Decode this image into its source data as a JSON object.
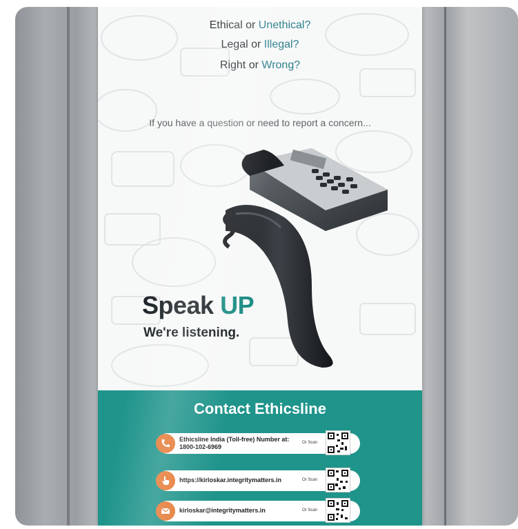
{
  "poster": {
    "questions": [
      {
        "a": "Ethical",
        "or": " or ",
        "b": "Unethical?"
      },
      {
        "a": "Legal",
        "or": " or ",
        "b": "Illegal?"
      },
      {
        "a": "Right",
        "or": " or ",
        "b": "Wrong?"
      }
    ],
    "prompt": "If you have a question or need to report a concern...",
    "headline_a": "Speak ",
    "headline_b": "UP",
    "tagline": "We're listening.",
    "contact_title": "Contact Ethicsline",
    "contacts": [
      {
        "icon": "phone-icon",
        "line1": "Ethicsline India (Toll-free) Number at:",
        "line2": "1800-102-6969",
        "or_scan": "Or Scan"
      },
      {
        "icon": "hand-pointer-icon",
        "line1": "https://kirloskar.integritymatters.in",
        "line2": "",
        "or_scan": "Or Scan"
      },
      {
        "icon": "envelope-icon",
        "line1": "kirloskar@integritymatters.in",
        "line2": "",
        "or_scan": "Or Scan"
      }
    ]
  },
  "colors": {
    "teal": "#1f948b",
    "accent_text": "#2b7f8c",
    "icon_orange": "#e67a35"
  }
}
